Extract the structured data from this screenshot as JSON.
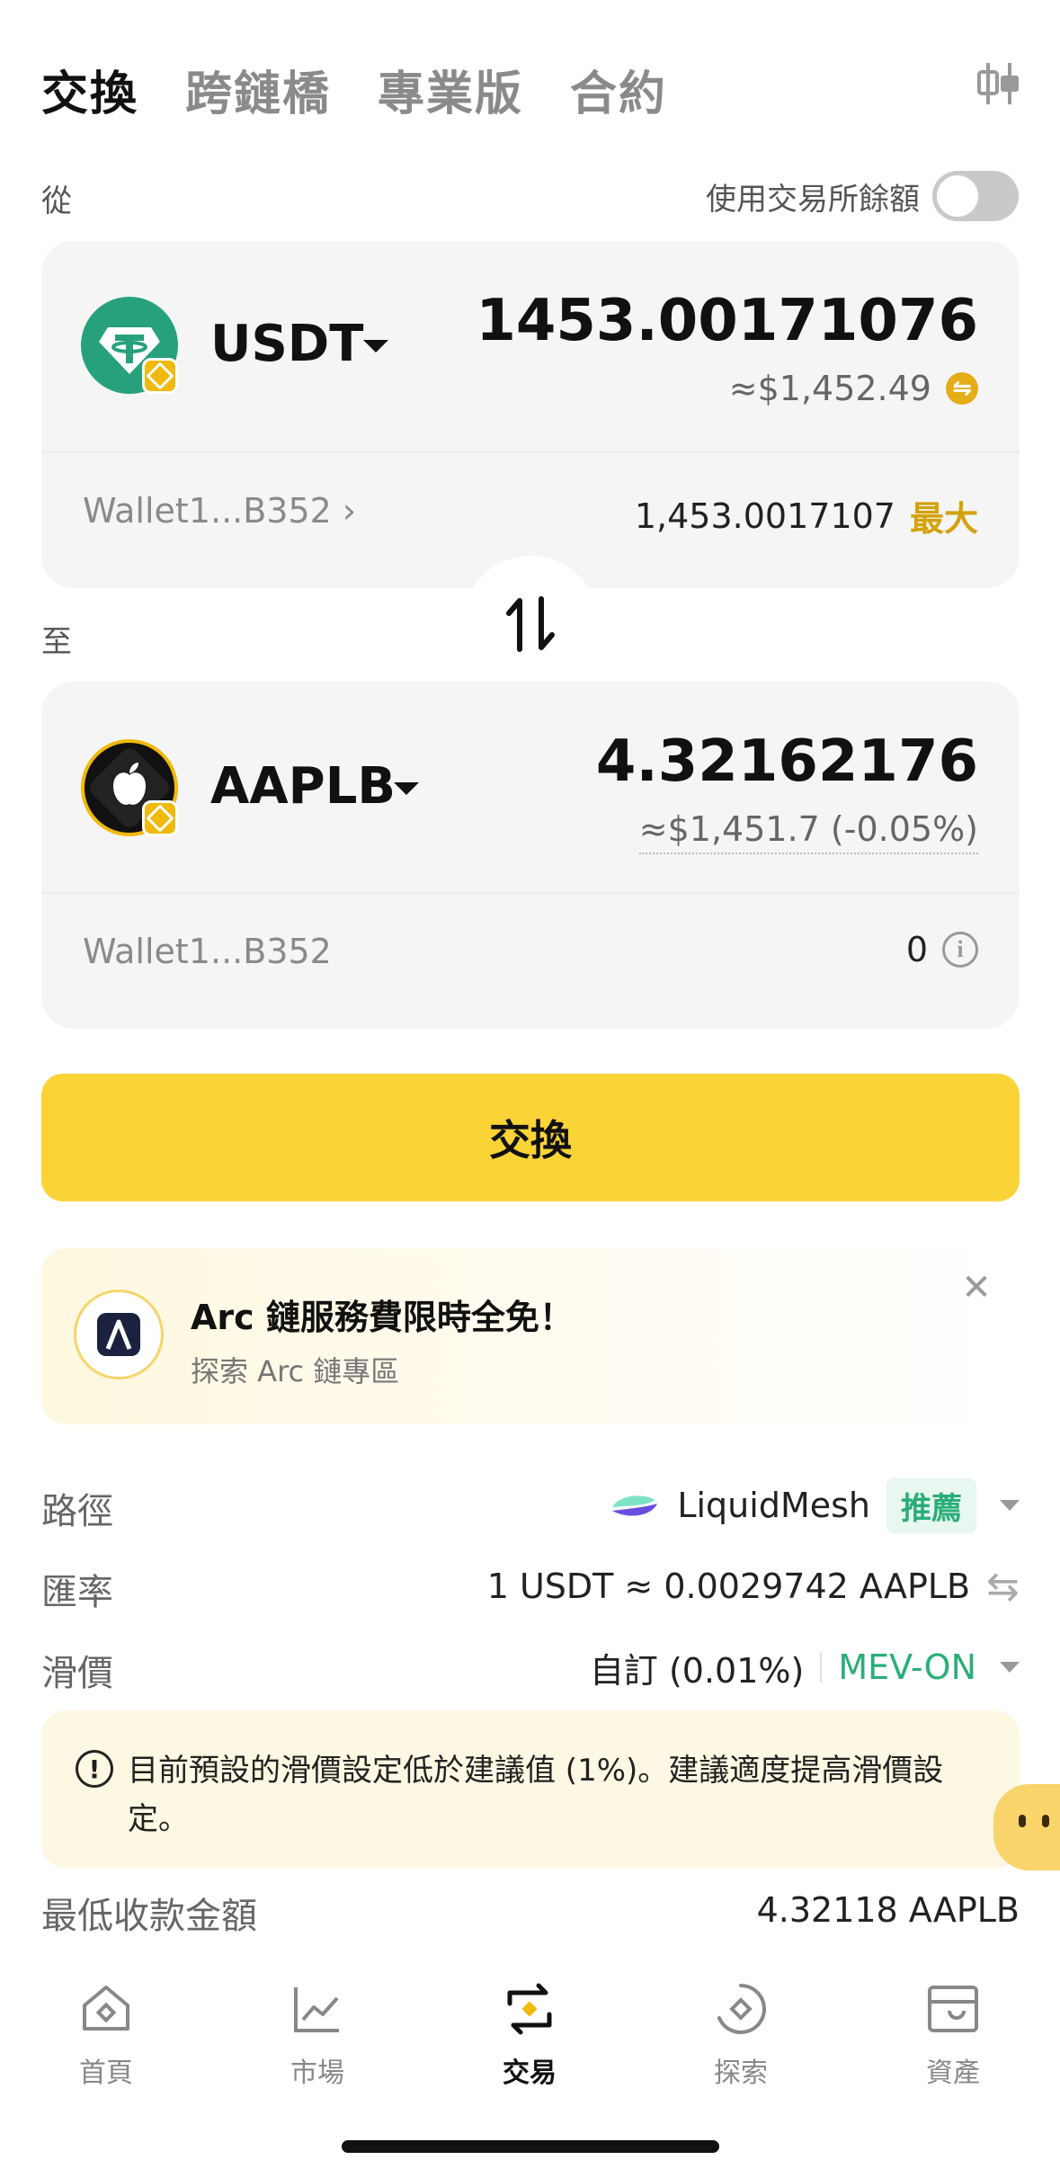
{
  "top_tabs": [
    "交換",
    "跨鏈橋",
    "專業版",
    "合約"
  ],
  "from": {
    "label": "從",
    "use_exchange_balance_label": "使用交易所餘額",
    "use_exchange_balance_on": false,
    "token": "USDT",
    "amount": "1453.00171076",
    "usd_value": "≈$1,452.49",
    "wallet": "Wallet1...B352",
    "balance": "1,453.0017107",
    "max_label": "最大"
  },
  "to": {
    "label": "至",
    "token": "AAPLB",
    "amount": "4.32162176",
    "usd_value": "≈$1,451.7 (-0.05%)",
    "wallet": "Wallet1...B352",
    "balance": "0"
  },
  "swap_button_label": "交換",
  "promo": {
    "title": "Arc 鏈服務費限時全免！",
    "subtitle": "探索 Arc 鏈專區"
  },
  "details": {
    "route_label": "路徑",
    "route_value": "LiquidMesh",
    "route_badge": "推薦",
    "rate_label": "匯率",
    "rate_value": "1 USDT ≈ 0.0029742 AAPLB",
    "slippage_label": "滑價",
    "slippage_value": "自訂 (0.01%)",
    "mev_label": "MEV-ON",
    "min_receive_label": "最低收款金額",
    "min_receive_value": "4.32118 AAPLB"
  },
  "warning_text": "目前預設的滑價設定低於建議值 (1%)。建議適度提高滑價設定。",
  "bottom_nav": [
    {
      "label": "首頁",
      "icon": "home-icon"
    },
    {
      "label": "市場",
      "icon": "market-chart-icon"
    },
    {
      "label": "交易",
      "icon": "trade-swap-icon"
    },
    {
      "label": "探索",
      "icon": "discover-compass-icon"
    },
    {
      "label": "資產",
      "icon": "wallet-assets-icon"
    }
  ],
  "colors": {
    "accent_yellow": "#fad337",
    "max_gold": "#d4a20c",
    "green": "#2aae77",
    "usdt_teal": "#26a17b"
  }
}
